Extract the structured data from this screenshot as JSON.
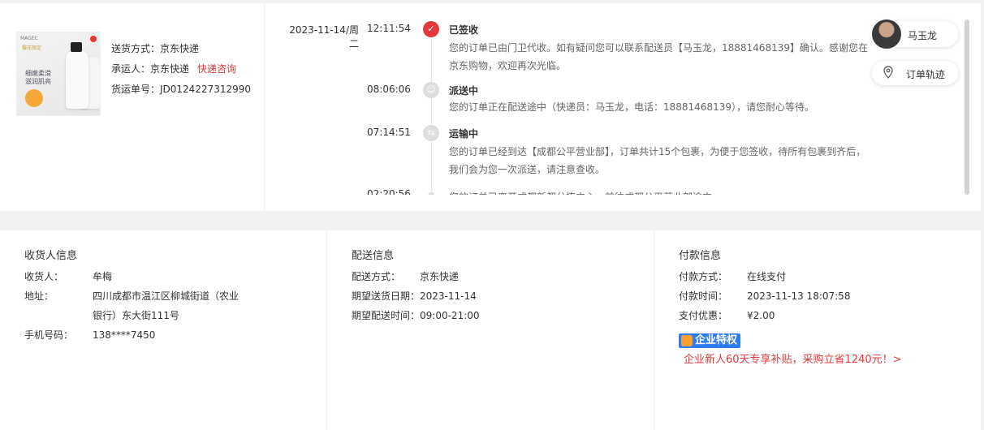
{
  "package": {
    "product_image": {
      "brand": "MAGEC",
      "crown_text": "樱花限定",
      "lines": [
        "细嫩柔滑",
        "滋润肌亮"
      ]
    },
    "ship_method": "送货方式：京东快递",
    "carrier": "承运人：京东快递",
    "consult_link": "快递咨询",
    "tracking_no": "货运单号：JD0124227312990"
  },
  "timeline": {
    "events": [
      {
        "date": "2023-11-14/周二",
        "time": "12:11:54",
        "status": "已签收",
        "icon": "check-icon",
        "desc": "您的订单已由门卫代收。如有疑问您可以联系配送员【马玉龙，18881468139】确认。感谢您在京东购物，欢迎再次光临。"
      },
      {
        "date": "",
        "time": "08:06:06",
        "status": "派送中",
        "icon": "courier-icon",
        "desc": "您的订单正在配送途中（快递员：马玉龙，电话：18881468139），请您耐心等待。"
      },
      {
        "date": "",
        "time": "07:14:51",
        "status": "运输中",
        "icon": "truck-icon",
        "desc": "您的订单已经到达【成都公平营业部】，订单共计15个包裹，为便于您签收，待所有包裹到齐后，我们会为您一次派送，请注意查收。"
      },
      {
        "date": "",
        "time": "02:20:56",
        "status": "",
        "icon": "dot-icon",
        "desc": "您的订单已离开成都新都分拣中心，前往成都公平营业部途中"
      }
    ]
  },
  "courier": {
    "name": "马玉龙"
  },
  "track_button": {
    "label": "订单轨迹"
  },
  "receiver": {
    "title": "收货人信息",
    "name_key": "收货人：",
    "name": "牟梅",
    "addr_key": "地址：",
    "addr": "四川成都市温江区柳城街道（农业银行）东大街111号",
    "phone_key": "手机号码：",
    "phone": "138****7450"
  },
  "delivery": {
    "title": "配送信息",
    "method_key": "配送方式：",
    "method": "京东快递",
    "date_key": "期望送货日期：",
    "date": "2023-11-14",
    "time_key": "期望配送时间：",
    "time": "09:00-21:00"
  },
  "payment": {
    "title": "付款信息",
    "method_key": "付款方式：",
    "method": "在线支付",
    "time_key": "付款时间：",
    "time": "2023-11-13 18:07:58",
    "discount_key": "支付优惠：",
    "discount": "¥2.00",
    "enterprise_tag": "企业特权",
    "promo": "企业新人60天专享补贴，采购立省1240元！>"
  },
  "colors": {
    "accent_red": "#e4393c",
    "enterprise_blue": "#2f7cf6"
  }
}
